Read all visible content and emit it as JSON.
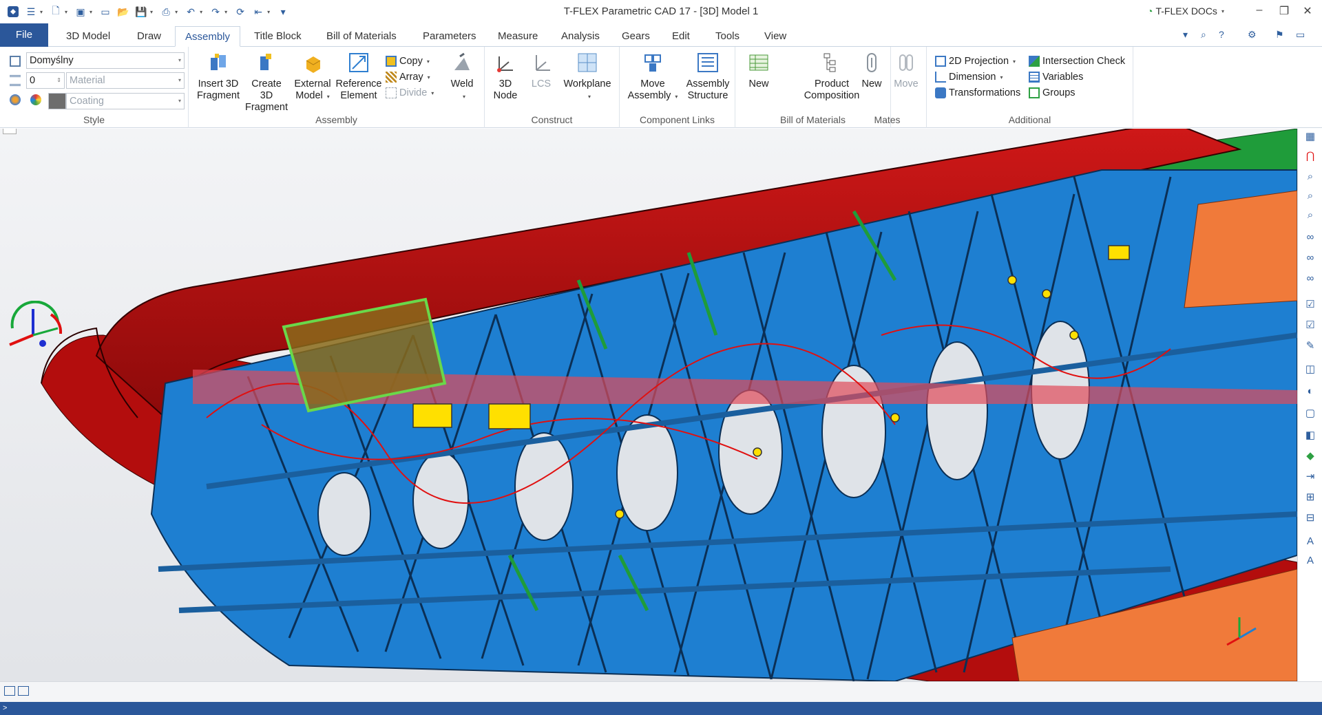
{
  "window": {
    "title": "T-FLEX Parametric CAD 17 - [3D] Model 1",
    "docs_label": "T-FLEX DOCs",
    "minimize": "–",
    "restore": "❐",
    "close": "✕"
  },
  "tabs": [
    {
      "label": "File"
    },
    {
      "label": "3D Model"
    },
    {
      "label": "Draw"
    },
    {
      "label": "Assembly"
    },
    {
      "label": "Title Block"
    },
    {
      "label": "Bill of Materials"
    },
    {
      "label": "Parameters"
    },
    {
      "label": "Measure"
    },
    {
      "label": "Analysis"
    },
    {
      "label": "Gears"
    },
    {
      "label": "Edit"
    },
    {
      "label": "Tools"
    },
    {
      "label": "View"
    }
  ],
  "style": {
    "style_value": "Domyślny",
    "layer_value": "0",
    "material_placeholder": "Material",
    "coating_placeholder": "Coating",
    "group_label": "Style"
  },
  "assembly": {
    "insert_line1": "Insert 3D",
    "insert_line2": "Fragment",
    "create_line1": "Create 3D",
    "create_line2": "Fragment",
    "external_line1": "External",
    "external_line2": "Model",
    "reference_line1": "Reference",
    "reference_line2": "Element",
    "copy": "Copy",
    "array": "Array",
    "divide": "Divide",
    "weld": "Weld",
    "group_label": "Assembly"
  },
  "construct": {
    "node_line1": "3D",
    "node_line2": "Node",
    "lcs": "LCS",
    "workplane": "Workplane",
    "group_label": "Construct"
  },
  "component_links": {
    "move_line1": "Move",
    "move_line2": "Assembly",
    "structure_line1": "Assembly",
    "structure_line2": "Structure",
    "group_label": "Component Links"
  },
  "bom": {
    "new": "New",
    "product_line1": "Product",
    "product_line2": "Composition",
    "group_label": "Bill of Materials"
  },
  "mates": {
    "new": "New",
    "move": "Move",
    "group_label": "Mates"
  },
  "additional": {
    "projection": "2D Projection",
    "dimension": "Dimension",
    "transformations": "Transformations",
    "intersection": "Intersection Check",
    "variables": "Variables",
    "groups": "Groups",
    "group_label": "Additional"
  },
  "status": {
    "text": ">"
  },
  "colors": {
    "accent": "#2b579a",
    "fuselage": "#b30d0d",
    "frame": "#1e7fd1",
    "selection": "#6ad84a"
  }
}
